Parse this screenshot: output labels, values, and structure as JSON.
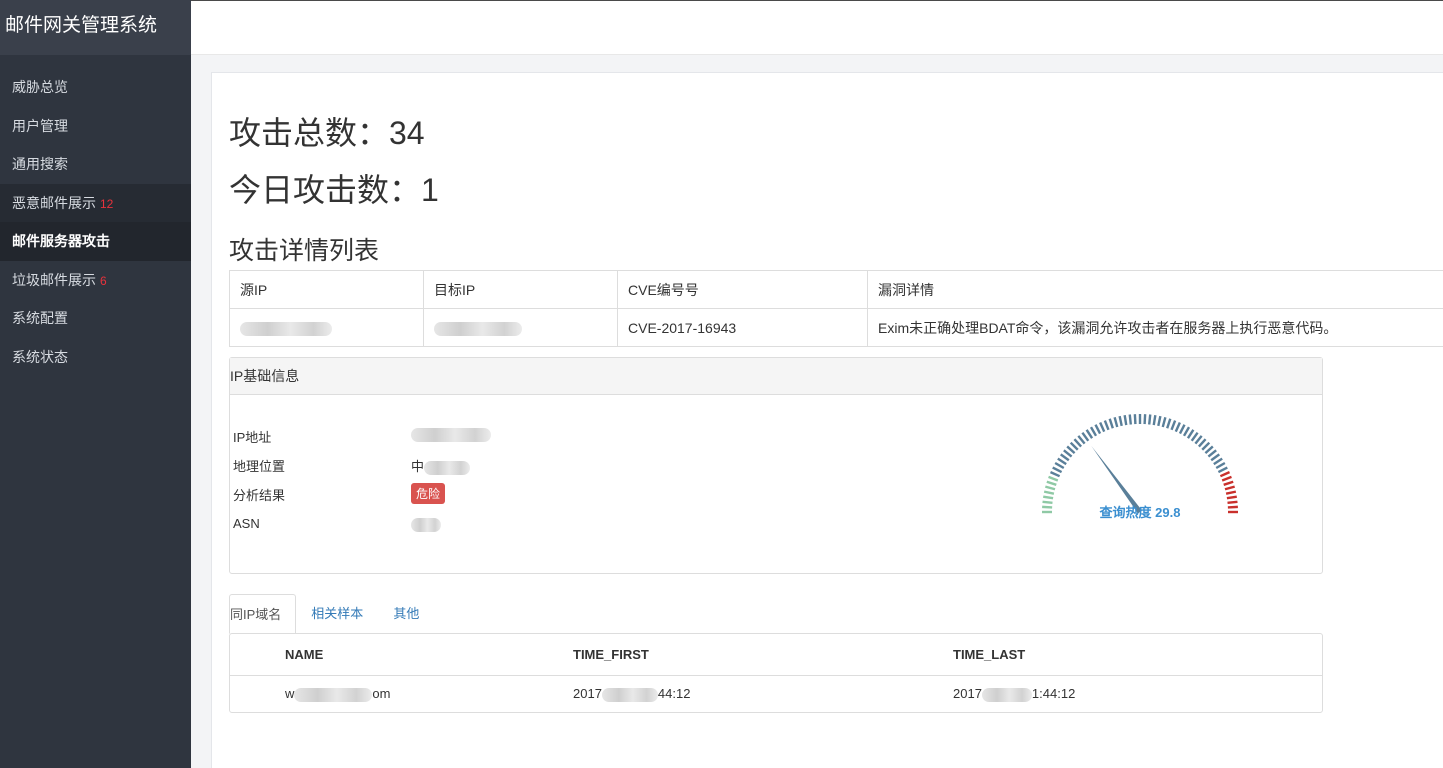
{
  "sidebar": {
    "brand": "邮件网关管理系统",
    "items": [
      {
        "label": "威胁总览",
        "badge": ""
      },
      {
        "label": "用户管理",
        "badge": ""
      },
      {
        "label": "通用搜索",
        "badge": ""
      },
      {
        "label": "恶意邮件展示",
        "badge": "12"
      },
      {
        "label": "邮件服务器攻击",
        "badge": ""
      },
      {
        "label": "垃圾邮件展示",
        "badge": "6"
      },
      {
        "label": "系统配置",
        "badge": ""
      },
      {
        "label": "系统状态",
        "badge": ""
      }
    ],
    "active_index": 4
  },
  "stats": {
    "total": "攻击总数：34",
    "today": "今日攻击数：1"
  },
  "attack_list": {
    "title": "攻击详情列表",
    "headers": [
      "源IP",
      "目标IP",
      "CVE编号号",
      "漏洞详情"
    ],
    "rows": [
      {
        "cve": "CVE-2017-16943",
        "detail": "Exim未正确处理BDAT命令，该漏洞允许攻击者在服务器上执行恶意代码。"
      }
    ]
  },
  "ip_info": {
    "title": "IP基础信息",
    "labels": {
      "ip": "IP地址",
      "location": "地理位置",
      "analysis": "分析结果",
      "asn": "ASN"
    },
    "location_prefix": "中",
    "analysis_badge": "危险",
    "gauge": {
      "label": "查询热度",
      "value": 29.8,
      "value_text": "29.8",
      "min": 0,
      "max": 100,
      "colors": {
        "low": "#8fc9a5",
        "mid": "#5a7f99",
        "high": "#c9302c",
        "needle": "#5a7f99",
        "text": "#3b8fd0"
      }
    }
  },
  "tabs": [
    {
      "label": "同IP域名",
      "active": true
    },
    {
      "label": "相关样本",
      "active": false
    },
    {
      "label": "其他",
      "active": false
    }
  ],
  "domains": {
    "headers": [
      "NAME",
      "TIME_FIRST",
      "TIME_LAST"
    ],
    "rows": [
      {
        "name_start": "w",
        "name_end": "om",
        "first_start": "2017",
        "first_end": "44:12",
        "last_start": "2017",
        "last_end": "1:44:12"
      }
    ]
  },
  "colors": {
    "sidebar_bg": "#2f353f",
    "badge_red": "#e8323c",
    "danger": "#d9534f",
    "link": "#337ab7"
  }
}
